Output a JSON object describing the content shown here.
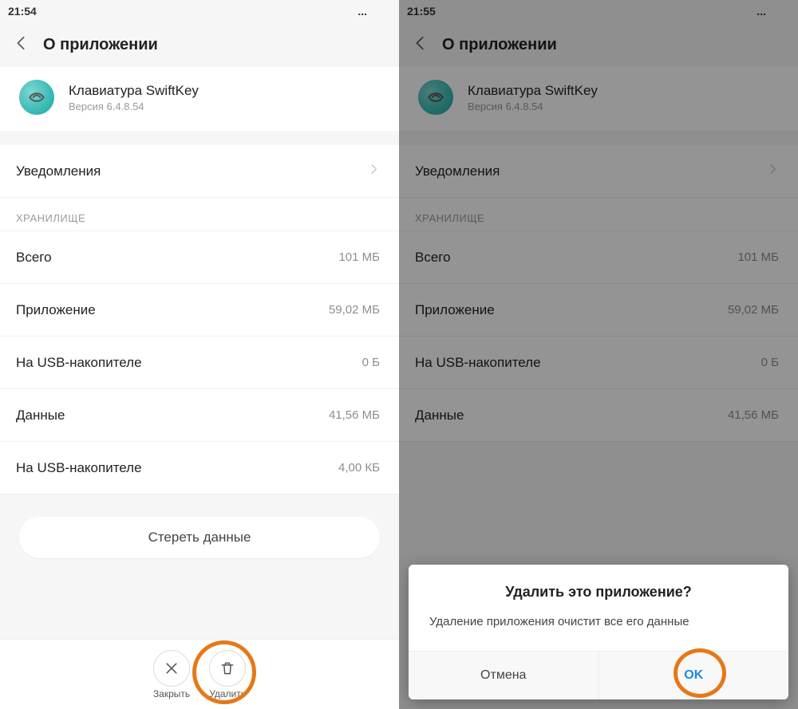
{
  "left": {
    "status": {
      "time": "21:54"
    },
    "header": {
      "title": "О приложении"
    },
    "app": {
      "name": "Клавиатура SwiftKey",
      "version": "Версия 6.4.8.54"
    },
    "rows": {
      "notifications": "Уведомления",
      "storage_title": "ХРАНИЛИЩЕ",
      "total_label": "Всего",
      "total_value": "101 МБ",
      "app_label": "Приложение",
      "app_value": "59,02 МБ",
      "usb1_label": "На USB-накопителе",
      "usb1_value": "0 Б",
      "data_label": "Данные",
      "data_value": "41,56 МБ",
      "usb2_label": "На USB-накопителе",
      "usb2_value": "4,00 КБ"
    },
    "footer": {
      "clear": "Стереть данные",
      "close": "Закрыть",
      "delete": "Удалить"
    }
  },
  "right": {
    "status": {
      "time": "21:55"
    },
    "header": {
      "title": "О приложении"
    },
    "app": {
      "name": "Клавиатура SwiftKey",
      "version": "Версия 6.4.8.54"
    },
    "rows": {
      "notifications": "Уведомления",
      "storage_title": "ХРАНИЛИЩЕ",
      "total_label": "Всего",
      "total_value": "101 МБ",
      "app_label": "Приложение",
      "app_value": "59,02 МБ",
      "usb1_label": "На USB-накопителе",
      "usb1_value": "0 Б",
      "data_label": "Данные",
      "data_value": "41,56 МБ"
    },
    "dialog": {
      "title": "Удалить это приложение?",
      "message": "Удаление приложения очистит все его данные",
      "cancel": "Отмена",
      "ok": "OK"
    }
  },
  "status_icons": {
    "dots": "...",
    "bluetooth": "bt",
    "alarm": "al",
    "wifi": "wf",
    "nosim": "ns",
    "battery": "ba"
  }
}
